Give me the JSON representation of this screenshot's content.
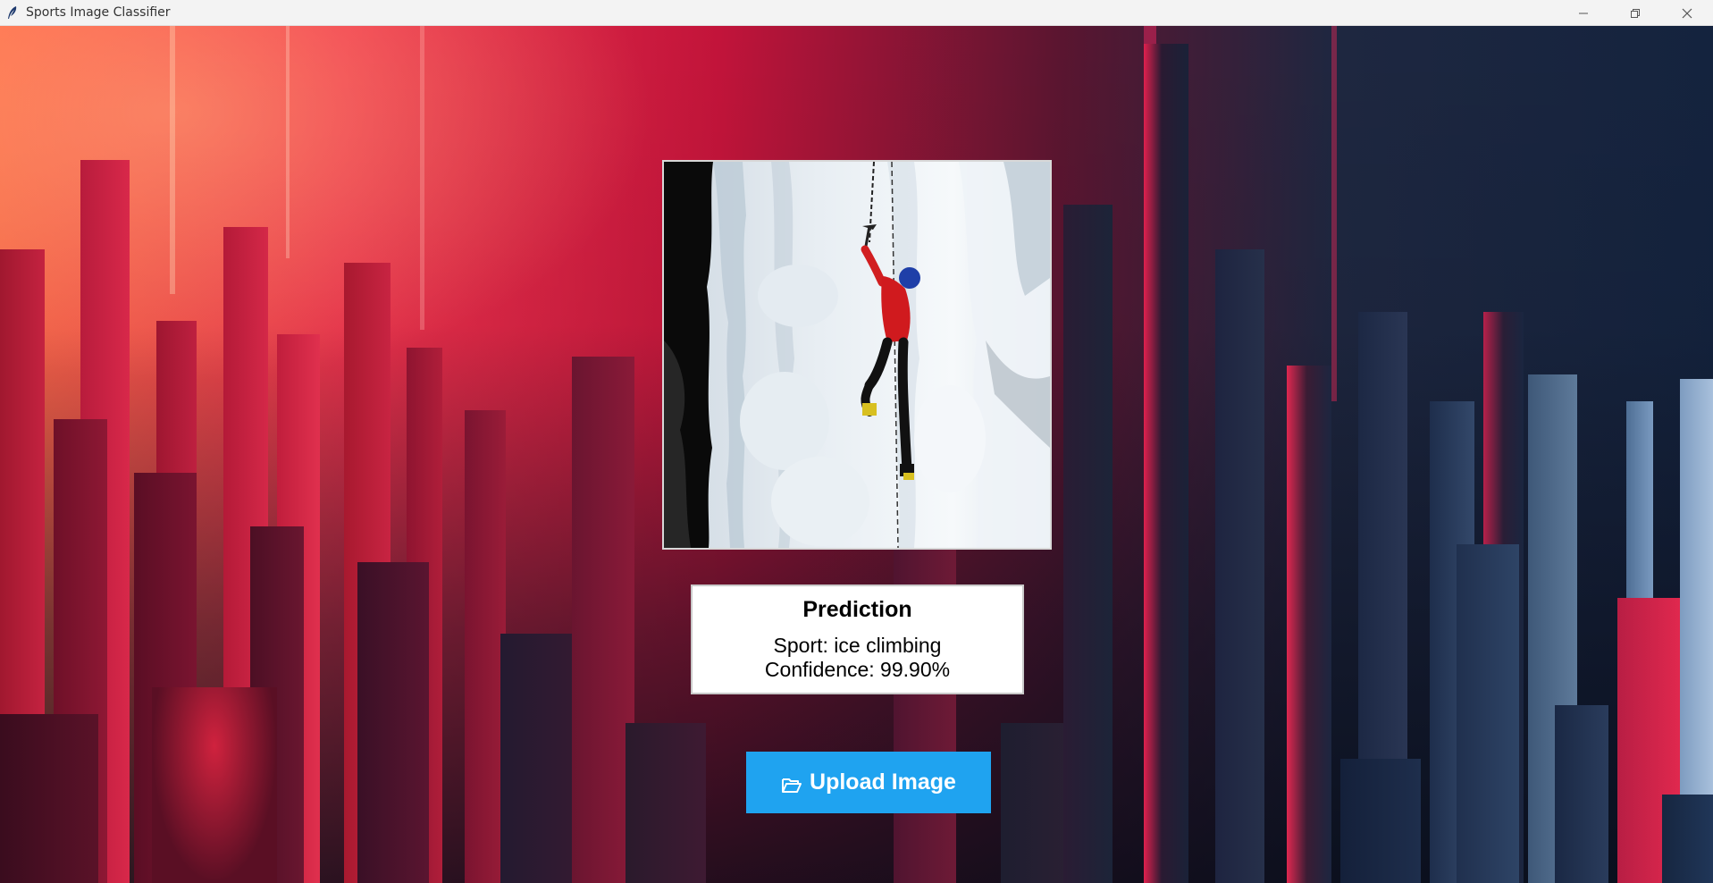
{
  "window": {
    "title": "Sports Image Classifier",
    "icon": "feather-icon"
  },
  "controls": {
    "minimize": "minimize-icon",
    "maximize": "restore-icon",
    "close": "close-icon"
  },
  "background": {
    "description_colors": [
      "#ff6a4a",
      "#f0344e",
      "#c2143a",
      "#14233e"
    ]
  },
  "preview": {
    "content": "ice-climber-photo"
  },
  "prediction": {
    "title": "Prediction",
    "sport_line": "Sport: ice climbing",
    "confidence_line": "Confidence: 99.90%"
  },
  "upload": {
    "label": "Upload Image",
    "icon": "folder-open-icon",
    "color": "#1fa3f0"
  }
}
